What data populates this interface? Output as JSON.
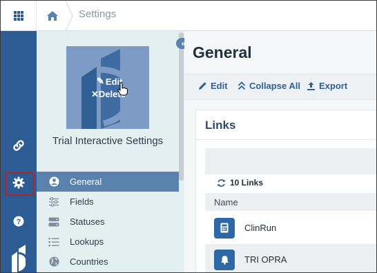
{
  "breadcrumb": {
    "current": "Settings"
  },
  "settings_panel": {
    "title": "Trial Interactive Settings",
    "avatar": {
      "edit_label": "Edit",
      "delete_label": "Delete"
    },
    "menu": [
      {
        "label": "General",
        "icon": "user-circle-icon",
        "active": true
      },
      {
        "label": "Fields",
        "icon": "sliders-icon",
        "active": false
      },
      {
        "label": "Statuses",
        "icon": "toggle-icon",
        "active": false
      },
      {
        "label": "Lookups",
        "icon": "list-icon",
        "active": false
      },
      {
        "label": "Countries",
        "icon": "globe-icon",
        "active": false
      }
    ]
  },
  "main": {
    "title": "General",
    "toolbar": {
      "edit_label": "Edit",
      "collapse_label": "Collapse All",
      "export_label": "Export"
    },
    "links_card": {
      "title": "Links",
      "count_label": "10 Links",
      "column_name": "Name",
      "rows": [
        {
          "label": "ClinRun",
          "icon": "calculator-icon"
        },
        {
          "label": "TRI OPRA",
          "icon": "bell-icon"
        }
      ]
    }
  },
  "colors": {
    "rail": "#2d5b93",
    "panel": "#e3eff0",
    "active_menu": "#5b82ad",
    "accent": "#2f5f93",
    "highlight_border": "#b0252a"
  }
}
